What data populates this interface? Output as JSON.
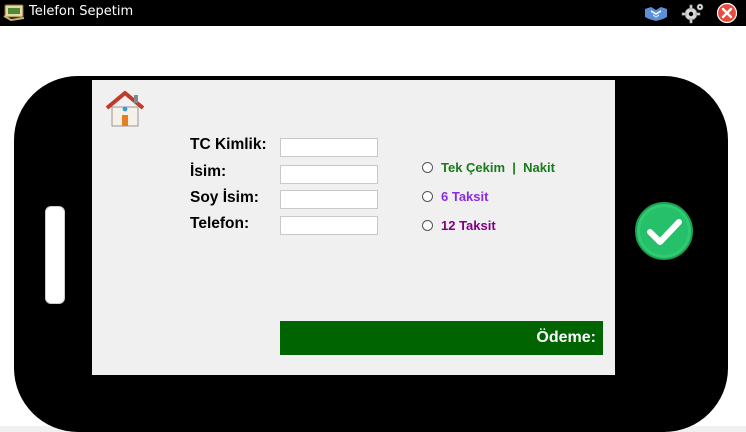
{
  "window": {
    "title": "Telefon Sepetim",
    "icons": [
      "app-cart-icon",
      "handshake-icon",
      "gear-icon",
      "close-icon"
    ]
  },
  "form": {
    "labels": [
      "TC Kimlik:",
      "İsim:",
      "Soy İsim:",
      "Telefon:"
    ],
    "values": [
      "",
      "",
      "",
      ""
    ]
  },
  "payment_options": [
    {
      "label": "Tek Çekim  |  Nakit",
      "color": "#1a7a1a",
      "selected": false
    },
    {
      "label": "6 Taksit",
      "color": "#8a2be2",
      "selected": false
    },
    {
      "label": "12 Taksit",
      "color": "#800080",
      "selected": false
    }
  ],
  "payment": {
    "label": "Ödeme:",
    "bar_color": "#006400"
  },
  "colors": {
    "phone_body": "#000000",
    "screen": "#f0f0f0",
    "confirm": "#2ecc71"
  },
  "screen_icons": [
    "home-icon",
    "checkmark-icon"
  ]
}
